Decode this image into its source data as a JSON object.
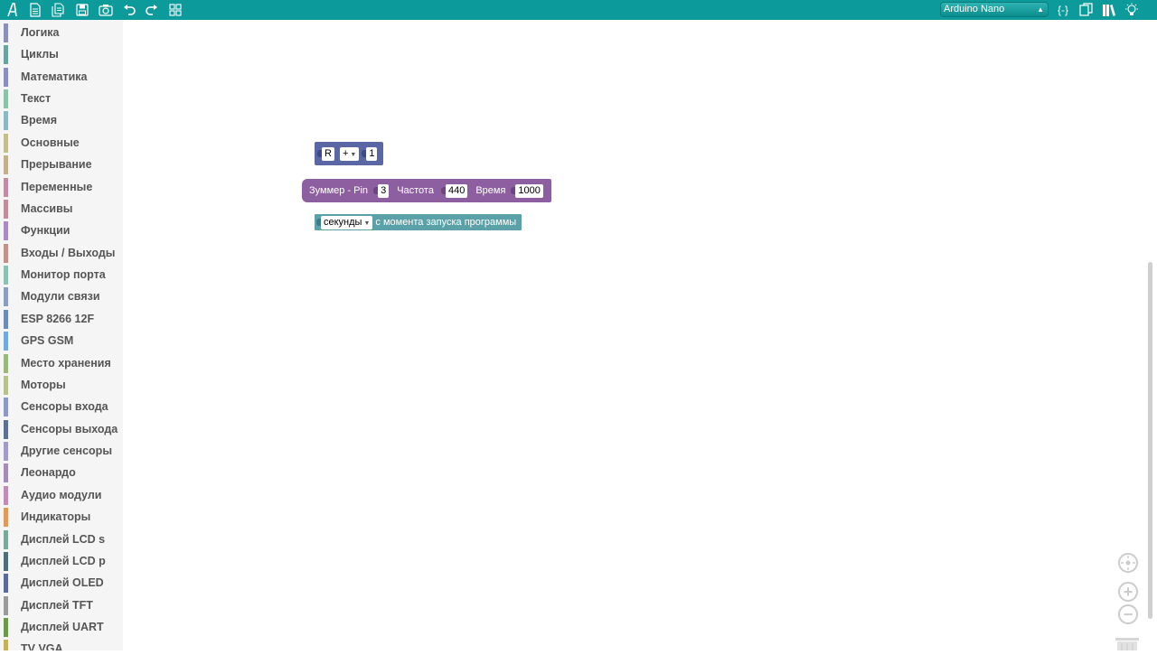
{
  "toolbar": {
    "icons": [
      "logo-icon",
      "new-file-icon",
      "open-file-icon",
      "save-icon",
      "screenshot-icon",
      "undo-icon",
      "redo-icon",
      "grid-icon",
      "code-braces-icon",
      "copy-icon",
      "library-icon",
      "lightbulb-icon"
    ],
    "board_select": "Arduino Nano",
    "code_label": "{-}"
  },
  "sidebar": {
    "categories": [
      {
        "label": "Логика",
        "color": "#8c8fb8"
      },
      {
        "label": "Циклы",
        "color": "#6aa39f"
      },
      {
        "label": "Математика",
        "color": "#8a8fbf"
      },
      {
        "label": "Текст",
        "color": "#8cc2a8"
      },
      {
        "label": "Время",
        "color": "#8cb8c2"
      },
      {
        "label": "Основные",
        "color": "#c2bf8c"
      },
      {
        "label": "Прерывание",
        "color": "#c2b28c"
      },
      {
        "label": "Переменные",
        "color": "#c28ca3"
      },
      {
        "label": "Массивы",
        "color": "#c28c9c"
      },
      {
        "label": "Функции",
        "color": "#a98cc2"
      },
      {
        "label": "Входы / Выходы",
        "color": "#c2938c"
      },
      {
        "label": "Монитор порта",
        "color": "#8cc2b4"
      },
      {
        "label": "Модули связи",
        "color": "#8c9dc2"
      },
      {
        "label": "ESP 8266 12F",
        "color": "#6b8bb8"
      },
      {
        "label": "GPS GSM",
        "color": "#74a8e0"
      },
      {
        "label": "Место хранения",
        "color": "#9ab87a"
      },
      {
        "label": "Моторы",
        "color": "#b8c28c"
      },
      {
        "label": "Сенсоры входа",
        "color": "#8c99c2"
      },
      {
        "label": "Сенсоры выхода",
        "color": "#5e6f94"
      },
      {
        "label": "Другие сенсоры",
        "color": "#a39cc9"
      },
      {
        "label": "Леонардо",
        "color": "#a38cb8"
      },
      {
        "label": "Аудио модули",
        "color": "#c28cb5"
      },
      {
        "label": "Индикаторы",
        "color": "#e09a5a"
      },
      {
        "label": "Дисплей LCD s",
        "color": "#7aa89a"
      },
      {
        "label": "Дисплей LCD p",
        "color": "#4f6f78"
      },
      {
        "label": "Дисплей OLED",
        "color": "#5a6a9a"
      },
      {
        "label": "Дисплей TFT",
        "color": "#9a9a9a"
      },
      {
        "label": "Дисплей UART",
        "color": "#6a9a4a"
      },
      {
        "label": "TV VGA",
        "color": "#c2b25a"
      }
    ]
  },
  "blocks": {
    "math": {
      "var": "R",
      "op": "+",
      "value": "1",
      "color": "#5b67a5"
    },
    "buzzer": {
      "label": "Зуммер - Pin",
      "pin": "3",
      "freq_label": "Частота",
      "freq": "440",
      "time_label": "Время",
      "time": "1000",
      "color": "#8e5fa0"
    },
    "millis": {
      "unit": "секунды",
      "label": "с момента запуска программы",
      "color": "#5ba1a8"
    }
  },
  "workspace_controls": {
    "icons": [
      "target-icon",
      "zoom-in-icon",
      "zoom-out-icon",
      "trash-icon"
    ],
    "zoom_in": "+",
    "zoom_out": "−"
  }
}
